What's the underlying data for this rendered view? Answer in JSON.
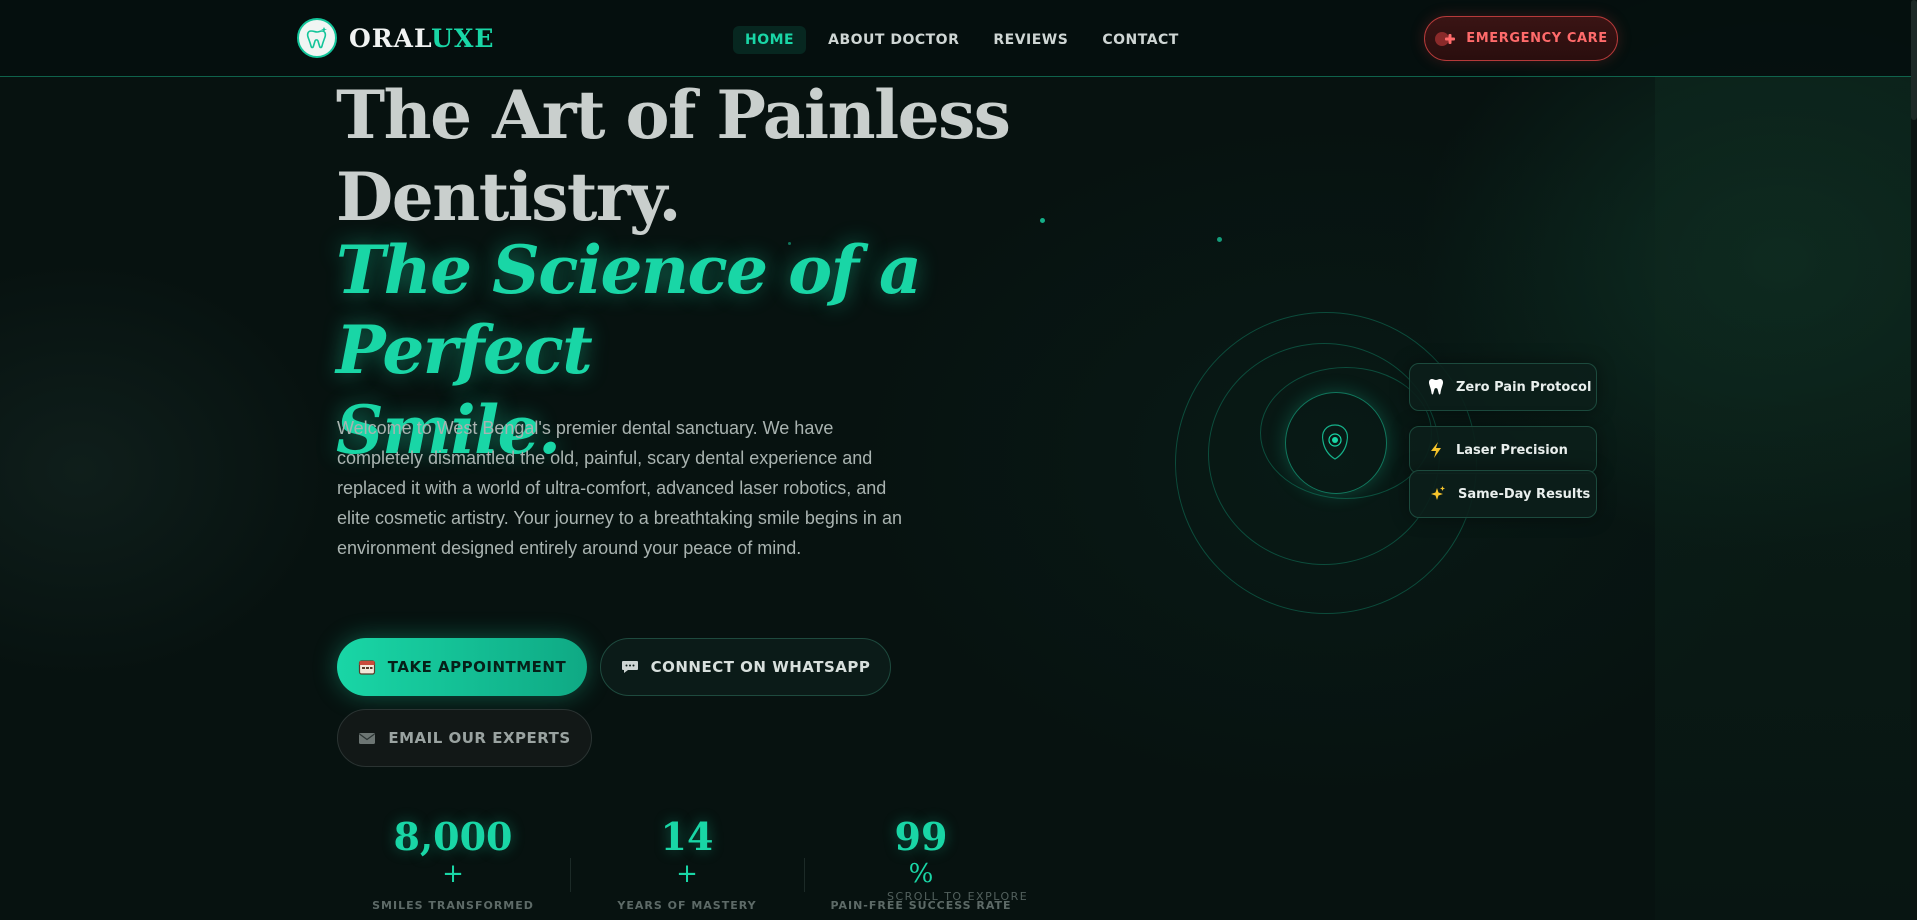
{
  "brand": {
    "name_prefix": "ORAL",
    "name_accent": "UXE"
  },
  "nav": {
    "items": [
      {
        "label": "HOME",
        "active": true
      },
      {
        "label": "ABOUT DOCTOR",
        "active": false
      },
      {
        "label": "REVIEWS",
        "active": false
      },
      {
        "label": "CONTACT",
        "active": false
      }
    ],
    "emergency_label": "EMERGENCY CARE"
  },
  "hero": {
    "title_line1": "The Art of Painless",
    "title_line2": "Dentistry.",
    "accent_line1": "The Science of a Perfect",
    "accent_line2": "Smile.",
    "description": "Welcome to West Bengal's premier dental sanctuary. We have completely dismantled the old, painful, scary dental experience and replaced it with a world of ultra-comfort, advanced laser robotics, and elite cosmetic artistry. Your journey to a breathtaking smile begins in an environment designed entirely around your peace of mind."
  },
  "buttons": {
    "appointment": "TAKE APPOINTMENT",
    "whatsapp": "CONNECT ON WHATSAPP",
    "email": "EMAIL OUR EXPERTS"
  },
  "stats": [
    {
      "value": "8,000",
      "suffix": "+",
      "label": "SMILES TRANSFORMED"
    },
    {
      "value": "14",
      "suffix": "+",
      "label": "YEARS OF MASTERY"
    },
    {
      "value": "99",
      "suffix": "%",
      "label": "PAIN-FREE SUCCESS RATE"
    }
  ],
  "scroll_hint": "SCROLL TO EXPLORE",
  "features": [
    {
      "label": "Zero Pain Protocol",
      "icon": "tooth-icon"
    },
    {
      "label": "Laser Precision",
      "icon": "lightning-icon"
    },
    {
      "label": "Same-Day Results",
      "icon": "sparkles-icon"
    }
  ],
  "colors": {
    "accent": "#19d6a6",
    "background": "#071210",
    "emergency": "#ff6b6b"
  }
}
